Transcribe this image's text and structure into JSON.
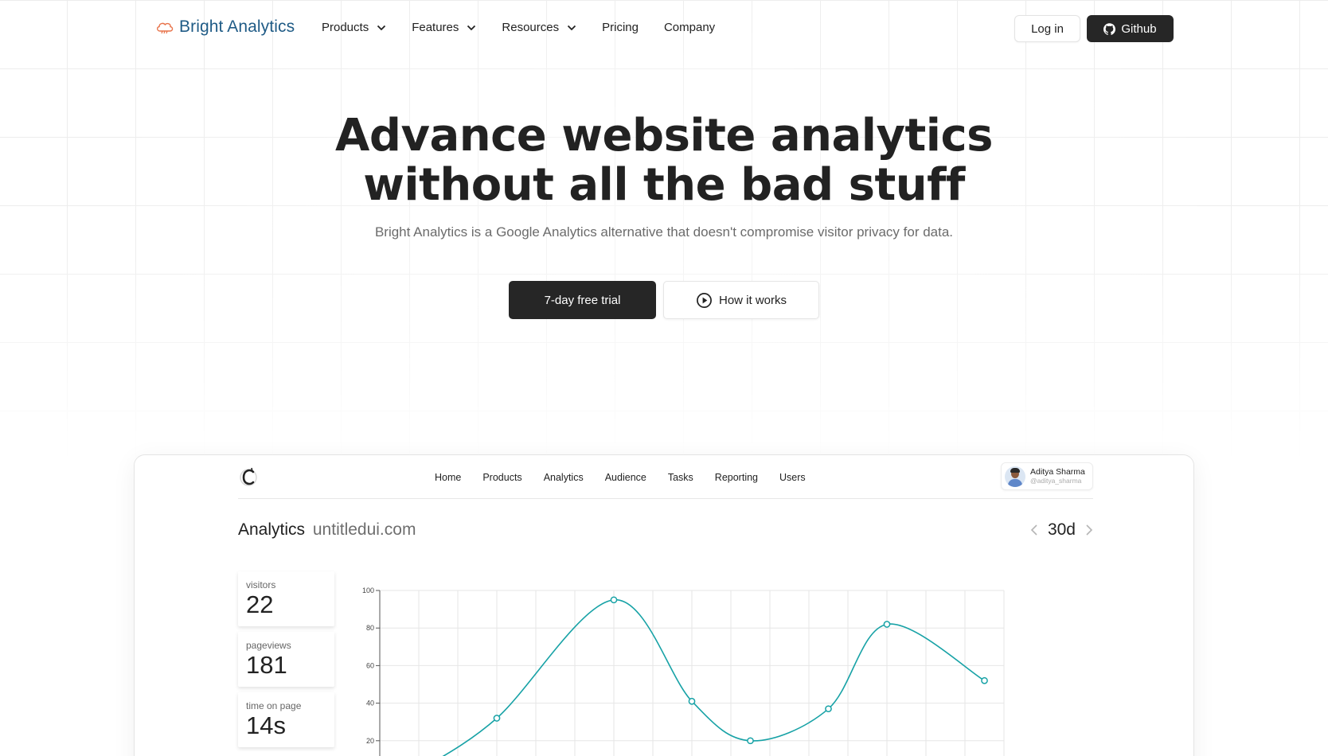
{
  "brand": {
    "name": "Bright Analytics",
    "logo_icon": "cloud-icon"
  },
  "nav": {
    "items": [
      {
        "label": "Products",
        "dropdown": true
      },
      {
        "label": "Features",
        "dropdown": true
      },
      {
        "label": "Resources",
        "dropdown": true
      },
      {
        "label": "Pricing",
        "dropdown": false
      },
      {
        "label": "Company",
        "dropdown": false
      }
    ],
    "login_label": "Log in",
    "github_label": "Github"
  },
  "hero": {
    "title_line1": "Advance website analytics",
    "title_line2": "without all the bad stuff",
    "subtitle": "Bright Analytics is a Google Analytics alternative that doesn't compromise visitor privacy for data.",
    "primary_cta": "7-day free trial",
    "secondary_cta": "How it works"
  },
  "dashboard": {
    "menu": [
      "Home",
      "Products",
      "Analytics",
      "Audience",
      "Tasks",
      "Reporting",
      "Users"
    ],
    "user": {
      "name": "Aditya Sharma",
      "handle": "@aditya_sharma"
    },
    "title": "Analytics",
    "domain": "untitledui.com",
    "period": "30d",
    "stats": [
      {
        "label": "visitors",
        "value": "22"
      },
      {
        "label": "pageviews",
        "value": "181"
      },
      {
        "label": "time on page",
        "value": "14s"
      }
    ]
  },
  "colors": {
    "accent_line": "#17a2a6",
    "dark_button": "#262626",
    "brand_blue": "#1f5b86",
    "logo_orange": "#e8734a"
  },
  "chart_data": {
    "type": "line",
    "x": [
      0,
      1,
      2,
      3,
      4,
      5,
      6,
      7,
      8,
      9,
      10,
      11,
      12,
      13,
      14,
      15,
      16
    ],
    "points": [
      {
        "x": 3,
        "y": 32
      },
      {
        "x": 6,
        "y": 95
      },
      {
        "x": 8,
        "y": 41
      },
      {
        "x": 9.5,
        "y": 20
      },
      {
        "x": 11.5,
        "y": 37
      },
      {
        "x": 13,
        "y": 82
      },
      {
        "x": 15.5,
        "y": 52
      }
    ],
    "yticks": [
      20,
      40,
      60,
      80,
      100
    ],
    "ylim": [
      0,
      100
    ],
    "xlim": [
      0,
      16
    ],
    "grid": true
  }
}
